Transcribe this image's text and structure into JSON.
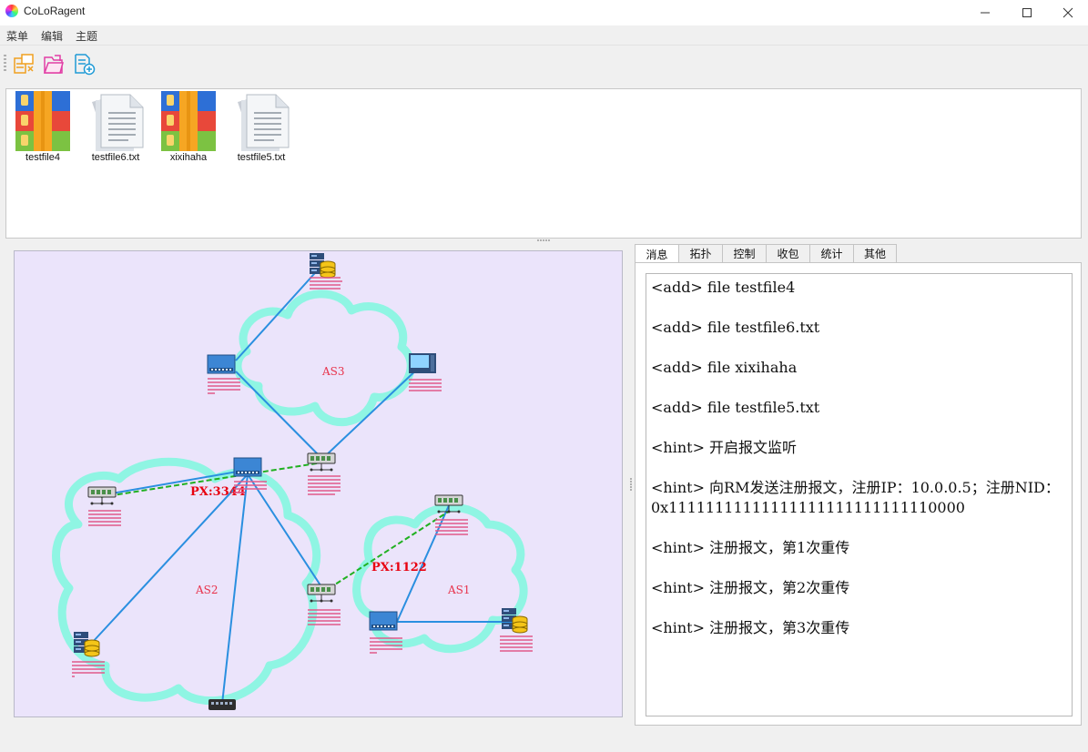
{
  "window": {
    "title": "CoLoRagent"
  },
  "menu": {
    "items": [
      "菜单",
      "编辑",
      "主题"
    ]
  },
  "toolbar": {
    "buttons": [
      "add-file-icon",
      "open-file-icon",
      "new-file-icon"
    ]
  },
  "files": [
    {
      "name": "testfile4",
      "icon": "archive-icon"
    },
    {
      "name": "testfile6.txt",
      "icon": "text-document-icon"
    },
    {
      "name": "xixihaha",
      "icon": "archive-icon"
    },
    {
      "name": "testfile5.txt",
      "icon": "text-document-icon"
    }
  ],
  "topology": {
    "domains": [
      "AS3",
      "AS2",
      "AS1"
    ],
    "px_labels": [
      "PX:3344",
      "PX:1122"
    ],
    "colors": {
      "background": "#ebe4fb",
      "cloud": "#8ff5e3",
      "link": "#2a8fe0",
      "px_link": "#20b020",
      "label": "#e8324b",
      "node_text": "#e15a8a"
    }
  },
  "tabs": [
    "消息",
    "拓扑",
    "控制",
    "收包",
    "统计",
    "其他"
  ],
  "active_tab": "消息",
  "log": [
    "<add> file testfile4",
    "<add> file testfile6.txt",
    "<add> file xixihaha",
    "<add> file testfile5.txt",
    "<hint> 开启报文监听",
    "<hint> 向RM发送注册报文，注册IP：10.0.0.5；注册NID：0x11111111111111111111111111110000",
    "<hint> 注册报文，第1次重传",
    "<hint> 注册报文，第2次重传",
    "<hint> 注册报文，第3次重传"
  ]
}
